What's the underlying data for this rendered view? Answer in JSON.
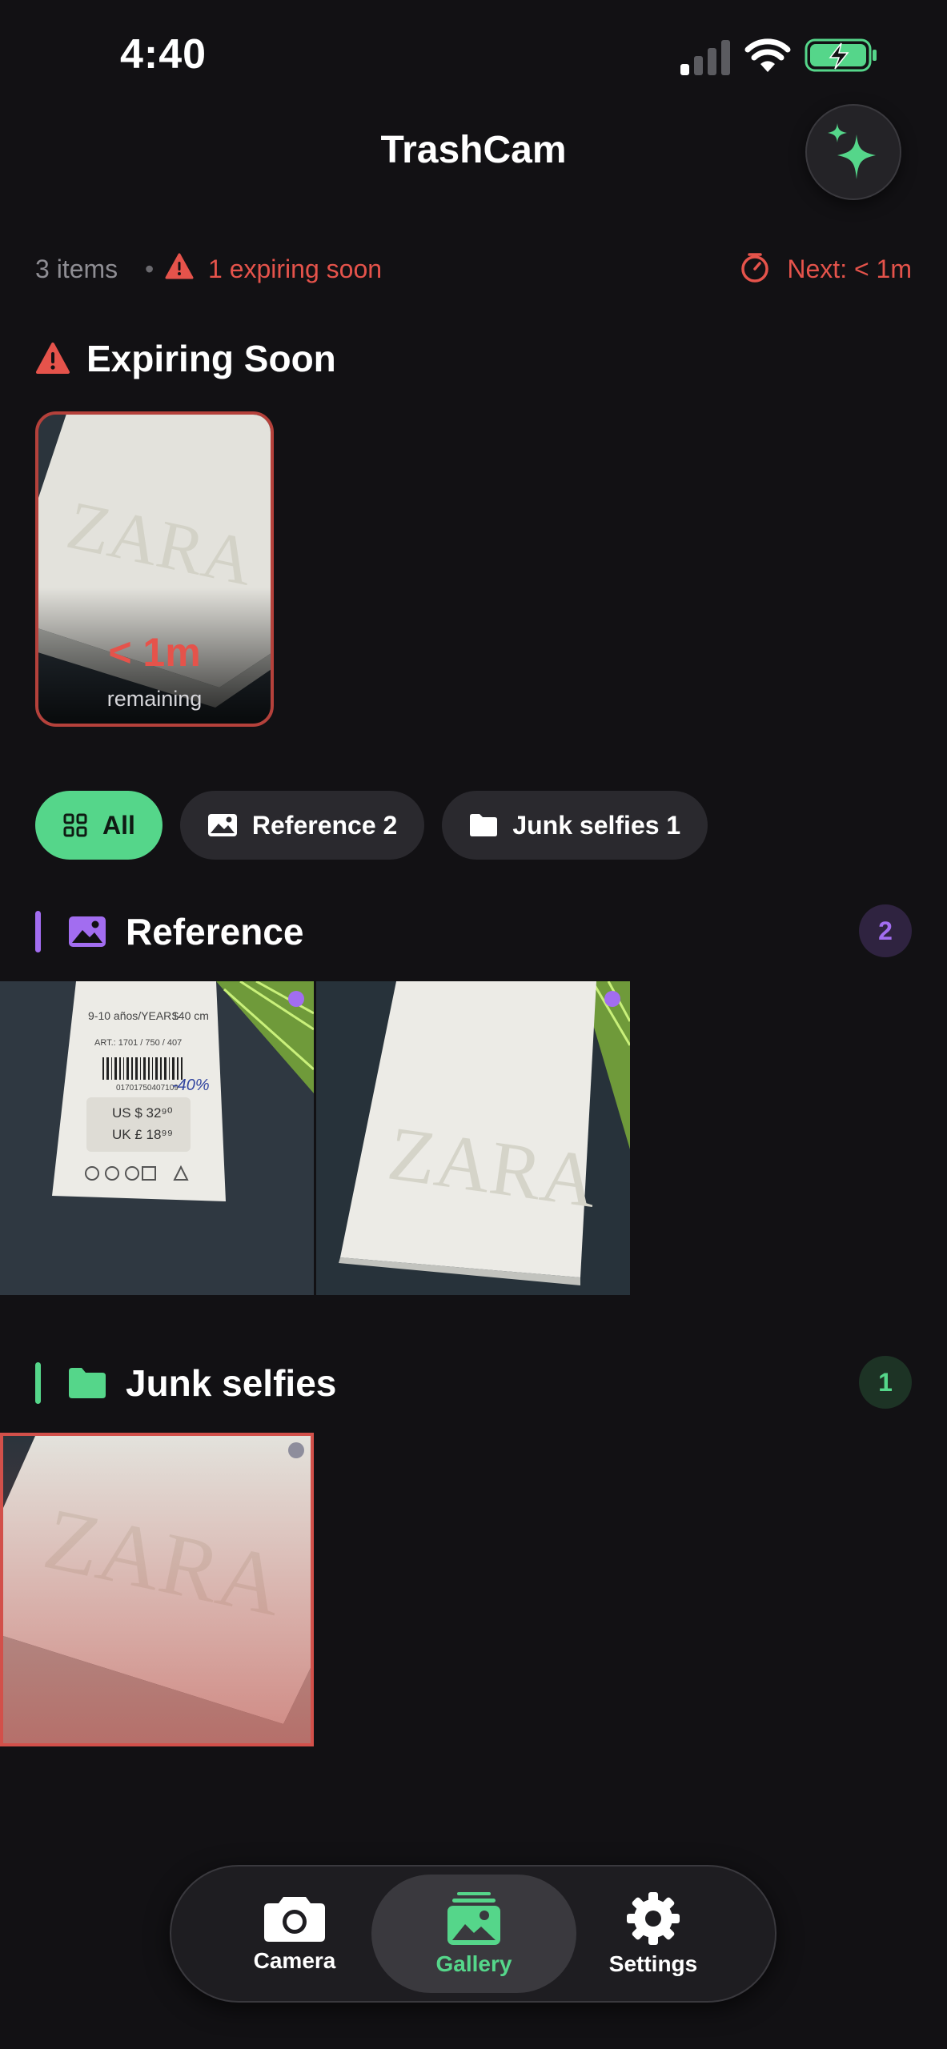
{
  "status_bar": {
    "time": "4:40"
  },
  "header": {
    "title": "TrashCam",
    "sparkle_icon": "sparkles-icon"
  },
  "summary": {
    "items_count": "3 items",
    "separator": "•",
    "expiring": "1 expiring soon",
    "next": "Next: < 1m"
  },
  "expiring_section": {
    "title": "Expiring Soon",
    "cards": [
      {
        "time_left": "< 1m",
        "remaining_label": "remaining"
      }
    ]
  },
  "filters": [
    {
      "label": "All",
      "icon": "grid-icon",
      "active": true
    },
    {
      "label": "Reference 2",
      "icon": "photo-icon",
      "active": false
    },
    {
      "label": "Junk selfies 1",
      "icon": "folder-icon",
      "active": false
    }
  ],
  "categories": [
    {
      "name": "Reference",
      "count": "2",
      "color": "#a26df0",
      "icon": "photo-icon"
    },
    {
      "name": "Junk selfies",
      "count": "1",
      "color": "#55d68a",
      "icon": "folder-icon"
    }
  ],
  "tag_photo": {
    "size_row": "9-10 años/YEARS",
    "size_cm": "140 cm",
    "art": "ART.: 1701 / 750 / 407",
    "barcode_num": "01701750407109",
    "discount": "-40%",
    "price_us": "US $ 32⁹⁰",
    "price_uk": "UK £ 18⁹⁹"
  },
  "box_photo_text": "ZARA",
  "tabs": [
    {
      "label": "Camera",
      "icon": "camera-icon",
      "active": false
    },
    {
      "label": "Gallery",
      "icon": "gallery-icon",
      "active": true
    },
    {
      "label": "Settings",
      "icon": "gear-icon",
      "active": false
    }
  ],
  "colors": {
    "accent_green": "#55d68a",
    "alert_red": "#e5534b",
    "reference_purple": "#a26df0",
    "background": "#121114"
  }
}
